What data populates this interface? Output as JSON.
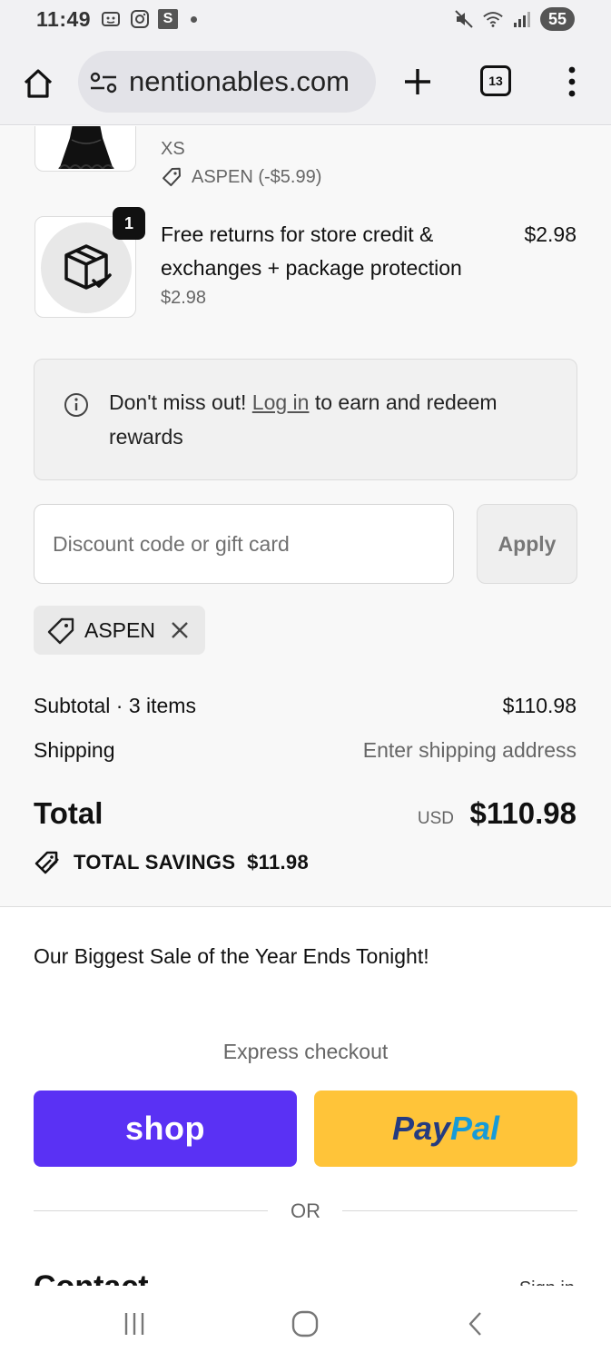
{
  "status_bar": {
    "time": "11:49",
    "left_icons": [
      "screenshot-icon",
      "instagram-icon",
      "s-app-icon",
      "notification-dot"
    ],
    "s_badge_label": "S",
    "right_icons": [
      "mute-icon",
      "wifi-icon",
      "signal-icon"
    ],
    "battery": "55"
  },
  "browser": {
    "url": "nentionables.com",
    "tab_count": "13",
    "home_icon": "home-icon",
    "tune_icon": "site-settings-icon",
    "new_tab_icon": "plus-icon",
    "menu_icon": "more-vert-icon"
  },
  "cart": {
    "items": [
      {
        "variant": "XS",
        "discount_label": "ASPEN (-$5.99)"
      },
      {
        "quantity": "1",
        "title_line1": "Free returns for store credit &",
        "title_line2": "exchanges + package protection",
        "unit_price": "$2.98",
        "price": "$2.98"
      }
    ]
  },
  "rewards": {
    "prefix": "Don't miss out!",
    "link": "Log in",
    "suffix": "to earn and redeem",
    "line2": "rewards"
  },
  "discount": {
    "placeholder": "Discount code or gift card",
    "value": "",
    "apply_label": "Apply",
    "applied_code": "ASPEN"
  },
  "totals": {
    "subtotal_label": "Subtotal · 3 items",
    "subtotal_value": "$110.98",
    "shipping_label": "Shipping",
    "shipping_value": "Enter shipping address",
    "total_label": "Total",
    "currency": "USD",
    "total_value": "$110.98",
    "savings_label": "TOTAL SAVINGS",
    "savings_value": "$11.98"
  },
  "promo_text": "Our Biggest Sale of the Year Ends Tonight!",
  "express": {
    "label": "Express checkout",
    "shop_label": "shop",
    "paypal_part1": "Pay",
    "paypal_part2": "Pal",
    "or_label": "OR"
  },
  "contact": {
    "heading": "Contact",
    "sign_in": "Sign in"
  },
  "colors": {
    "shop_purple": "#5a31f4",
    "paypal_yellow": "#ffc439",
    "paypal_dark_blue": "#253b80",
    "paypal_light_blue": "#179bd7"
  }
}
